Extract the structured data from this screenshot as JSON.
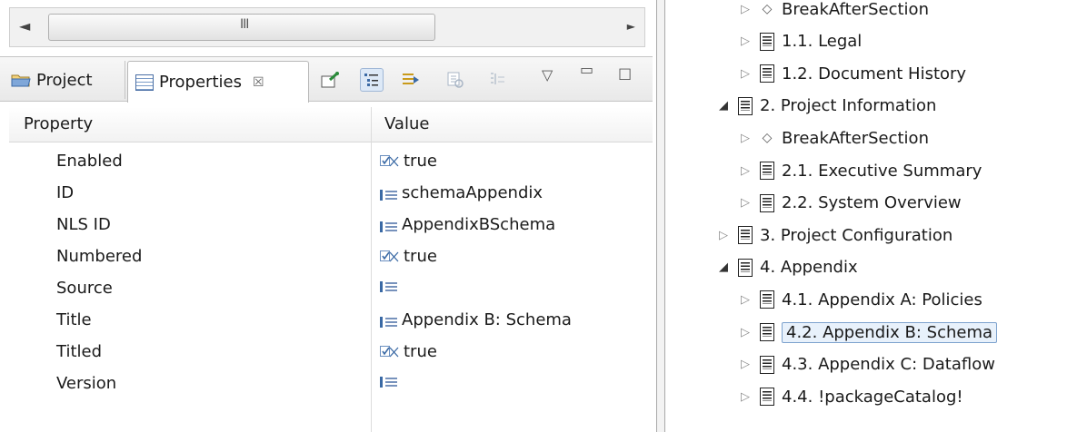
{
  "left_panel": {
    "scrollbar": {
      "left_arrow": "◄",
      "right_arrow": "►",
      "grip": "III"
    },
    "tabs": [
      {
        "label": "Project",
        "icon": "folder-icon"
      },
      {
        "label": "Properties",
        "icon": "table-icon",
        "close": "☒"
      }
    ],
    "view_menu": {
      "dropdown": "▽",
      "minimize": "▭",
      "maximize": "☐"
    },
    "table": {
      "headers": {
        "property": "Property",
        "value": "Value"
      },
      "rows": [
        {
          "key": "Enabled",
          "value": "true",
          "icon": "boolean-icon"
        },
        {
          "key": "ID",
          "value": "schemaAppendix",
          "icon": "text-icon"
        },
        {
          "key": "NLS ID",
          "value": "AppendixBSchema",
          "icon": "text-icon"
        },
        {
          "key": "Numbered",
          "value": "true",
          "icon": "boolean-icon"
        },
        {
          "key": "Source",
          "value": "",
          "icon": "text-icon"
        },
        {
          "key": "Title",
          "value": "Appendix B: Schema",
          "icon": "text-icon"
        },
        {
          "key": "Titled",
          "value": "true",
          "icon": "boolean-icon"
        },
        {
          "key": "Version",
          "value": "",
          "icon": "text-icon"
        }
      ]
    }
  },
  "outline": {
    "nodes": [
      {
        "label": "BreakAfterSection",
        "type": "diamond",
        "expander": "▷"
      },
      {
        "label": "1.1. Legal",
        "type": "doc",
        "expander": "▷"
      },
      {
        "label": "1.2. Document History",
        "type": "doc",
        "expander": "▷"
      },
      {
        "label": "2. Project Information",
        "type": "doc",
        "expander": "◢"
      },
      {
        "label": "BreakAfterSection",
        "type": "diamond",
        "expander": "▷"
      },
      {
        "label": "2.1. Executive Summary",
        "type": "doc",
        "expander": "▷"
      },
      {
        "label": "2.2. System Overview",
        "type": "doc",
        "expander": "▷"
      },
      {
        "label": "3. Project Configuration",
        "type": "doc",
        "expander": "▷"
      },
      {
        "label": "4. Appendix",
        "type": "doc",
        "expander": "◢"
      },
      {
        "label": "4.1. Appendix A: Policies",
        "type": "doc",
        "expander": "▷"
      },
      {
        "label": "4.2. Appendix B: Schema",
        "type": "doc",
        "expander": "▷",
        "selected": true
      },
      {
        "label": "4.3. Appendix C: Dataflow",
        "type": "doc",
        "expander": "▷"
      },
      {
        "label": "4.4. !packageCatalog!",
        "type": "doc",
        "expander": "▷"
      }
    ]
  }
}
